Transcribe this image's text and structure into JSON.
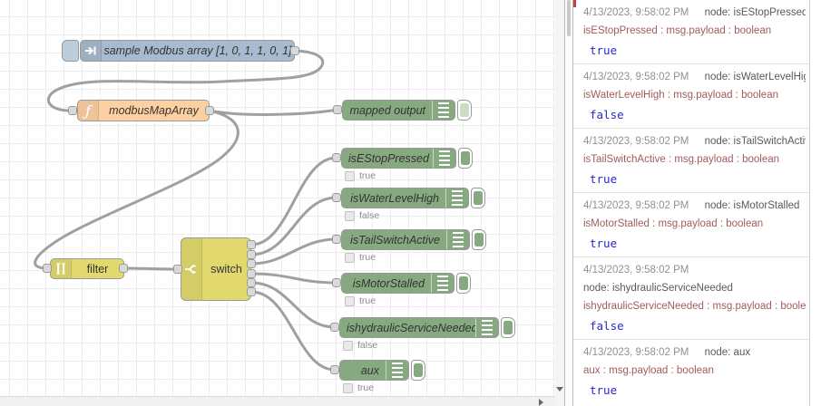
{
  "canvas": {
    "inject_node": {
      "label": "sample Modbus array [1, 0, 1, 1, 0, 1]"
    },
    "function_node": {
      "label": "modbusMapArray",
      "icon_glyph": "ƒ"
    },
    "filter_node": {
      "label": "filter",
      "icon_glyph": "∏"
    },
    "switch_node": {
      "label": "switch"
    },
    "debug_nodes": [
      {
        "label": "mapped output"
      },
      {
        "label": "isEStopPressed",
        "status": "true"
      },
      {
        "label": "isWaterLevelHigh",
        "status": "false"
      },
      {
        "label": "isTailSwitchActive",
        "status": "true"
      },
      {
        "label": "isMotorStalled",
        "status": "true"
      },
      {
        "label": "ishydraulicServiceNeeded",
        "status": "false"
      },
      {
        "label": "aux",
        "status": "true"
      }
    ]
  },
  "sidebar": {
    "messages": [
      {
        "timestamp": "4/13/2023, 9:58:02 PM",
        "node": "node: isEStopPressed",
        "meta": "isEStopPressed : msg.payload : boolean",
        "value": "true"
      },
      {
        "timestamp": "4/13/2023, 9:58:02 PM",
        "node": "node: isWaterLevelHigh",
        "meta": "isWaterLevelHigh : msg.payload : boolean",
        "value": "false"
      },
      {
        "timestamp": "4/13/2023, 9:58:02 PM",
        "node": "node: isTailSwitchActive",
        "meta": "isTailSwitchActive : msg.payload : boolean",
        "value": "true"
      },
      {
        "timestamp": "4/13/2023, 9:58:02 PM",
        "node": "node: isMotorStalled",
        "meta": "isMotorStalled : msg.payload : boolean",
        "value": "true"
      },
      {
        "timestamp": "4/13/2023, 9:58:02 PM",
        "node": "node: ishydraulicServiceNeeded",
        "meta": "ishydraulicServiceNeeded : msg.payload : boolean",
        "value": "false"
      },
      {
        "timestamp": "4/13/2023, 9:58:02 PM",
        "node": "node: aux",
        "meta": "aux : msg.payload : boolean",
        "value": "true"
      }
    ]
  },
  "colors": {
    "inject_fill": "#a6bbcf",
    "function_fill": "#fdd0a2",
    "debug_fill": "#87a980",
    "switch_fill": "#e2d96e",
    "node_border": "#999999",
    "wire": "#a0a0a0",
    "debug_meta_text": "#a05c5c",
    "debug_value_text": "#2727cf",
    "timestamp_text": "#909090"
  }
}
